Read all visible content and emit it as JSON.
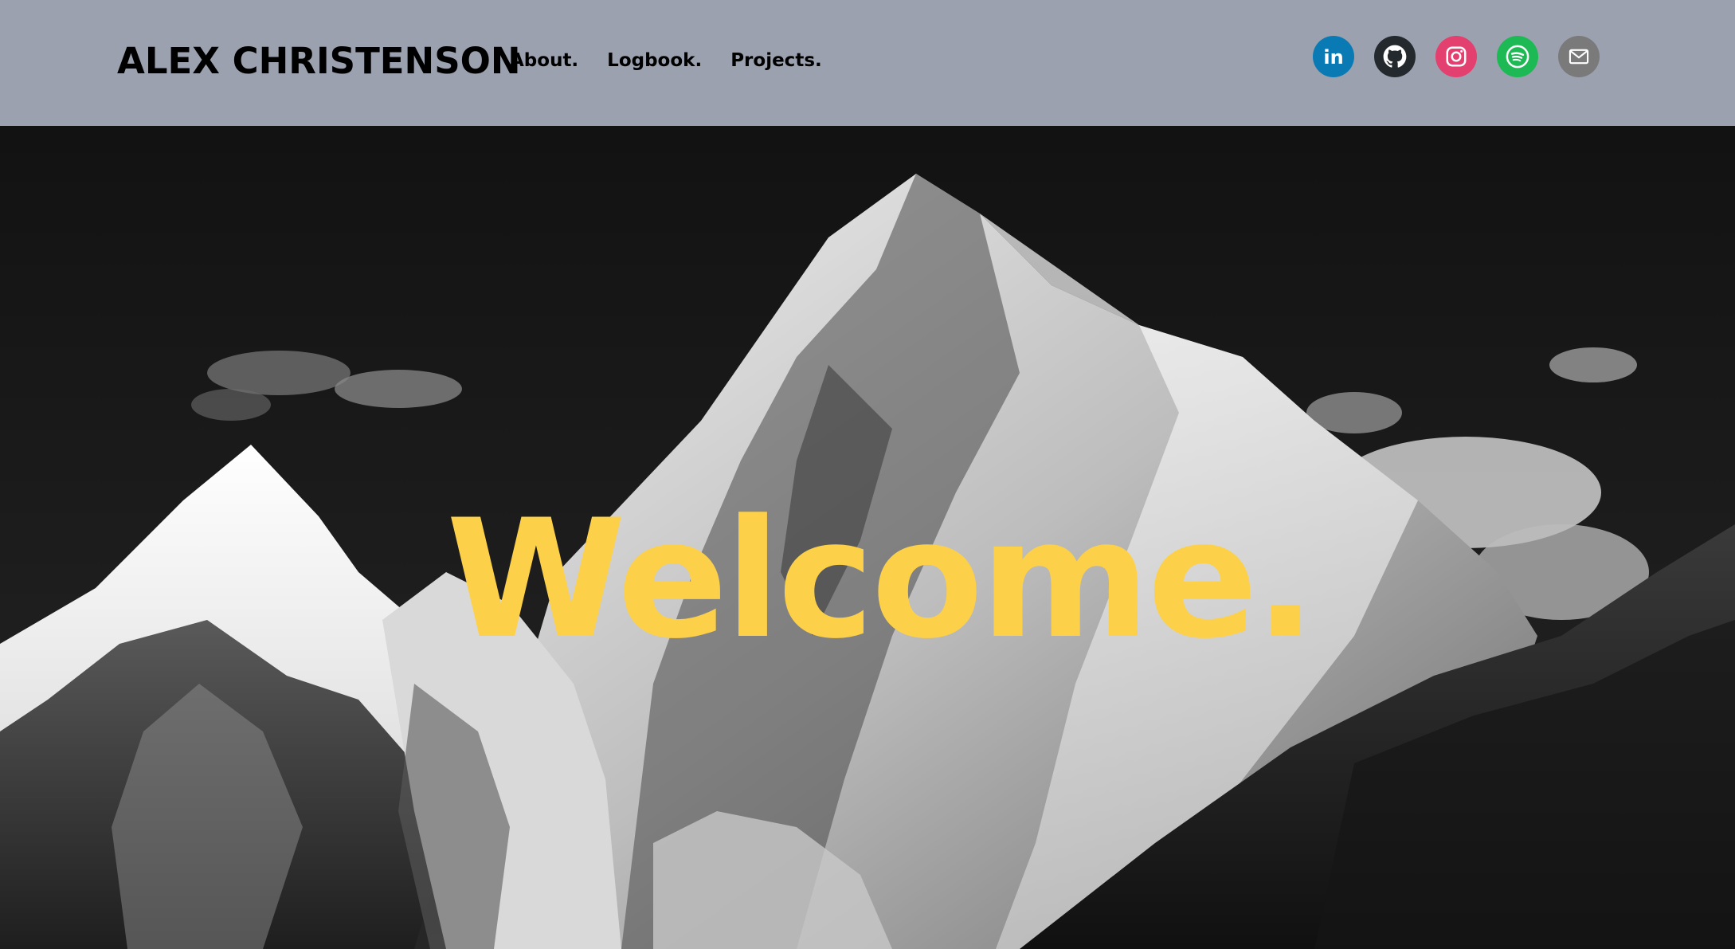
{
  "header": {
    "brand": "ALEX CHRISTENSON",
    "nav": [
      {
        "label": "About."
      },
      {
        "label": "Logbook."
      },
      {
        "label": "Projects."
      }
    ],
    "socials": [
      {
        "icon": "linkedin-icon",
        "color": "#0a7ab5",
        "glyph": "in"
      },
      {
        "icon": "github-icon",
        "color": "#24292e"
      },
      {
        "icon": "instagram-icon",
        "color": "#e4406f"
      },
      {
        "icon": "spotify-icon",
        "color": "#1db954"
      },
      {
        "icon": "email-icon",
        "color": "#7a7a7a"
      }
    ],
    "background": "#9ba1ae"
  },
  "hero": {
    "heading": "Welcome.",
    "heading_color": "#fdd04a",
    "image": "black-and-white-mountain-peak"
  }
}
